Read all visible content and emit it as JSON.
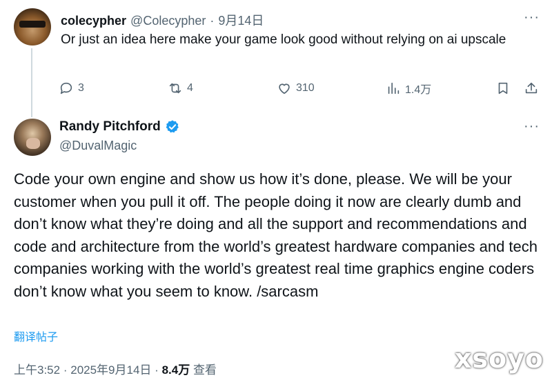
{
  "reply_tweet": {
    "name": "colecypher",
    "handle": "@Colecypher",
    "separator": "·",
    "date": "9月14日",
    "more": "···",
    "text": "Or just an idea here make your game look good without relying on ai upscale",
    "actions": {
      "replies": "3",
      "retweets": "4",
      "likes": "310",
      "views": "1.4万"
    }
  },
  "main_tweet": {
    "name": "Randy Pitchford",
    "handle": "@DuvalMagic",
    "more": "···",
    "text": "Code your own engine and show us how it’s done, please.  We will be your customer when you pull it off. The people doing it now are clearly dumb and don’t know what they’re doing and all the support and recommendations and code and architecture from the world’s greatest hardware companies and tech companies working with the world’s greatest real time graphics engine coders don’t know what you seem to know. /sarcasm",
    "translate_label": "翻译帖子",
    "meta": {
      "time": "上午3:52",
      "separator": "·",
      "date": "2025年9月14日",
      "views_count": "8.4万",
      "views_label": "查看"
    }
  },
  "watermark": "xsoyo",
  "colors": {
    "text_primary": "#0f1419",
    "text_secondary": "#536471",
    "accent": "#1d9bf0",
    "thread_line": "#cfd9de"
  },
  "icons": [
    "reply-icon",
    "retweet-icon",
    "like-icon",
    "views-icon",
    "bookmark-icon",
    "share-icon",
    "verified-icon",
    "more-icon"
  ]
}
